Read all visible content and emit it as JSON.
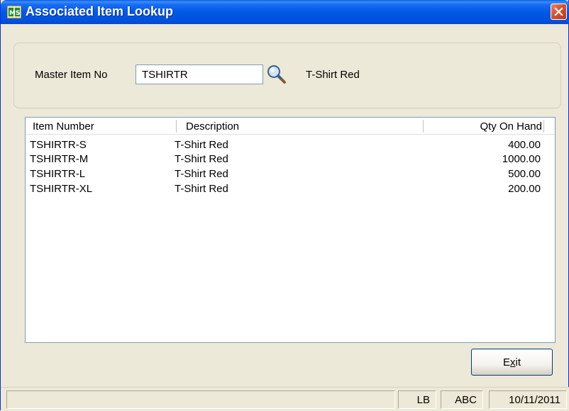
{
  "window": {
    "title": "Associated Item Lookup",
    "icon": "sage-app-icon",
    "close_icon": "close-icon"
  },
  "form": {
    "master_item_label": "Master Item No",
    "master_item_value": "TSHIRTR",
    "lookup_icon": "magnifier-icon",
    "master_item_description": "T-Shirt Red"
  },
  "list": {
    "columns": [
      "Item Number",
      "Description",
      "Qty On Hand"
    ],
    "rows": [
      {
        "item": "TSHIRTR-S",
        "description": "T-Shirt Red",
        "qty": "400.00"
      },
      {
        "item": "TSHIRTR-M",
        "description": "T-Shirt Red",
        "qty": "1000.00"
      },
      {
        "item": "TSHIRTR-L",
        "description": "T-Shirt Red",
        "qty": "500.00"
      },
      {
        "item": "TSHIRTR-XL",
        "description": "T-Shirt Red",
        "qty": "200.00"
      }
    ]
  },
  "buttons": {
    "exit_label_pre": "E",
    "exit_label_mnemonic": "x",
    "exit_label_post": "it"
  },
  "status": {
    "main": "",
    "user": "LB",
    "company": "ABC",
    "date": "10/11/2011"
  },
  "colors": {
    "titlebar": "#0058e6",
    "close_button": "#d8512e",
    "window_bg": "#ece9d8"
  }
}
